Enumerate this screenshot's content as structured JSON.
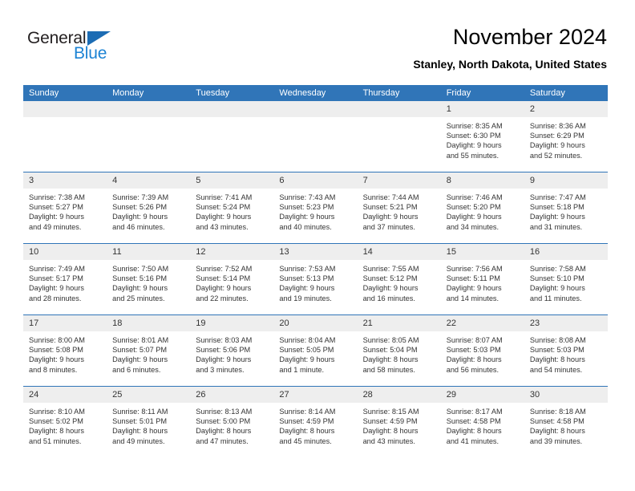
{
  "logo": {
    "word_one": "General",
    "word_two": "Blue",
    "triangle_color": "#1c6cb4",
    "blue_color": "#1c83d4",
    "dark_color": "#231f20"
  },
  "header": {
    "title": "November 2024",
    "subtitle": "Stanley, North Dakota, United States",
    "accent_color": "#3075b8",
    "daynum_bg": "#eeeeee"
  },
  "calendar": {
    "weekday_headers": [
      "Sunday",
      "Monday",
      "Tuesday",
      "Wednesday",
      "Thursday",
      "Friday",
      "Saturday"
    ],
    "weeks": [
      [
        {
          "day": "",
          "lines": []
        },
        {
          "day": "",
          "lines": []
        },
        {
          "day": "",
          "lines": []
        },
        {
          "day": "",
          "lines": []
        },
        {
          "day": "",
          "lines": []
        },
        {
          "day": "1",
          "lines": [
            "Sunrise: 8:35 AM",
            "Sunset: 6:30 PM",
            "Daylight: 9 hours",
            "and 55 minutes."
          ]
        },
        {
          "day": "2",
          "lines": [
            "Sunrise: 8:36 AM",
            "Sunset: 6:29 PM",
            "Daylight: 9 hours",
            "and 52 minutes."
          ]
        }
      ],
      [
        {
          "day": "3",
          "lines": [
            "Sunrise: 7:38 AM",
            "Sunset: 5:27 PM",
            "Daylight: 9 hours",
            "and 49 minutes."
          ]
        },
        {
          "day": "4",
          "lines": [
            "Sunrise: 7:39 AM",
            "Sunset: 5:26 PM",
            "Daylight: 9 hours",
            "and 46 minutes."
          ]
        },
        {
          "day": "5",
          "lines": [
            "Sunrise: 7:41 AM",
            "Sunset: 5:24 PM",
            "Daylight: 9 hours",
            "and 43 minutes."
          ]
        },
        {
          "day": "6",
          "lines": [
            "Sunrise: 7:43 AM",
            "Sunset: 5:23 PM",
            "Daylight: 9 hours",
            "and 40 minutes."
          ]
        },
        {
          "day": "7",
          "lines": [
            "Sunrise: 7:44 AM",
            "Sunset: 5:21 PM",
            "Daylight: 9 hours",
            "and 37 minutes."
          ]
        },
        {
          "day": "8",
          "lines": [
            "Sunrise: 7:46 AM",
            "Sunset: 5:20 PM",
            "Daylight: 9 hours",
            "and 34 minutes."
          ]
        },
        {
          "day": "9",
          "lines": [
            "Sunrise: 7:47 AM",
            "Sunset: 5:18 PM",
            "Daylight: 9 hours",
            "and 31 minutes."
          ]
        }
      ],
      [
        {
          "day": "10",
          "lines": [
            "Sunrise: 7:49 AM",
            "Sunset: 5:17 PM",
            "Daylight: 9 hours",
            "and 28 minutes."
          ]
        },
        {
          "day": "11",
          "lines": [
            "Sunrise: 7:50 AM",
            "Sunset: 5:16 PM",
            "Daylight: 9 hours",
            "and 25 minutes."
          ]
        },
        {
          "day": "12",
          "lines": [
            "Sunrise: 7:52 AM",
            "Sunset: 5:14 PM",
            "Daylight: 9 hours",
            "and 22 minutes."
          ]
        },
        {
          "day": "13",
          "lines": [
            "Sunrise: 7:53 AM",
            "Sunset: 5:13 PM",
            "Daylight: 9 hours",
            "and 19 minutes."
          ]
        },
        {
          "day": "14",
          "lines": [
            "Sunrise: 7:55 AM",
            "Sunset: 5:12 PM",
            "Daylight: 9 hours",
            "and 16 minutes."
          ]
        },
        {
          "day": "15",
          "lines": [
            "Sunrise: 7:56 AM",
            "Sunset: 5:11 PM",
            "Daylight: 9 hours",
            "and 14 minutes."
          ]
        },
        {
          "day": "16",
          "lines": [
            "Sunrise: 7:58 AM",
            "Sunset: 5:10 PM",
            "Daylight: 9 hours",
            "and 11 minutes."
          ]
        }
      ],
      [
        {
          "day": "17",
          "lines": [
            "Sunrise: 8:00 AM",
            "Sunset: 5:08 PM",
            "Daylight: 9 hours",
            "and 8 minutes."
          ]
        },
        {
          "day": "18",
          "lines": [
            "Sunrise: 8:01 AM",
            "Sunset: 5:07 PM",
            "Daylight: 9 hours",
            "and 6 minutes."
          ]
        },
        {
          "day": "19",
          "lines": [
            "Sunrise: 8:03 AM",
            "Sunset: 5:06 PM",
            "Daylight: 9 hours",
            "and 3 minutes."
          ]
        },
        {
          "day": "20",
          "lines": [
            "Sunrise: 8:04 AM",
            "Sunset: 5:05 PM",
            "Daylight: 9 hours",
            "and 1 minute."
          ]
        },
        {
          "day": "21",
          "lines": [
            "Sunrise: 8:05 AM",
            "Sunset: 5:04 PM",
            "Daylight: 8 hours",
            "and 58 minutes."
          ]
        },
        {
          "day": "22",
          "lines": [
            "Sunrise: 8:07 AM",
            "Sunset: 5:03 PM",
            "Daylight: 8 hours",
            "and 56 minutes."
          ]
        },
        {
          "day": "23",
          "lines": [
            "Sunrise: 8:08 AM",
            "Sunset: 5:03 PM",
            "Daylight: 8 hours",
            "and 54 minutes."
          ]
        }
      ],
      [
        {
          "day": "24",
          "lines": [
            "Sunrise: 8:10 AM",
            "Sunset: 5:02 PM",
            "Daylight: 8 hours",
            "and 51 minutes."
          ]
        },
        {
          "day": "25",
          "lines": [
            "Sunrise: 8:11 AM",
            "Sunset: 5:01 PM",
            "Daylight: 8 hours",
            "and 49 minutes."
          ]
        },
        {
          "day": "26",
          "lines": [
            "Sunrise: 8:13 AM",
            "Sunset: 5:00 PM",
            "Daylight: 8 hours",
            "and 47 minutes."
          ]
        },
        {
          "day": "27",
          "lines": [
            "Sunrise: 8:14 AM",
            "Sunset: 4:59 PM",
            "Daylight: 8 hours",
            "and 45 minutes."
          ]
        },
        {
          "day": "28",
          "lines": [
            "Sunrise: 8:15 AM",
            "Sunset: 4:59 PM",
            "Daylight: 8 hours",
            "and 43 minutes."
          ]
        },
        {
          "day": "29",
          "lines": [
            "Sunrise: 8:17 AM",
            "Sunset: 4:58 PM",
            "Daylight: 8 hours",
            "and 41 minutes."
          ]
        },
        {
          "day": "30",
          "lines": [
            "Sunrise: 8:18 AM",
            "Sunset: 4:58 PM",
            "Daylight: 8 hours",
            "and 39 minutes."
          ]
        }
      ]
    ]
  }
}
